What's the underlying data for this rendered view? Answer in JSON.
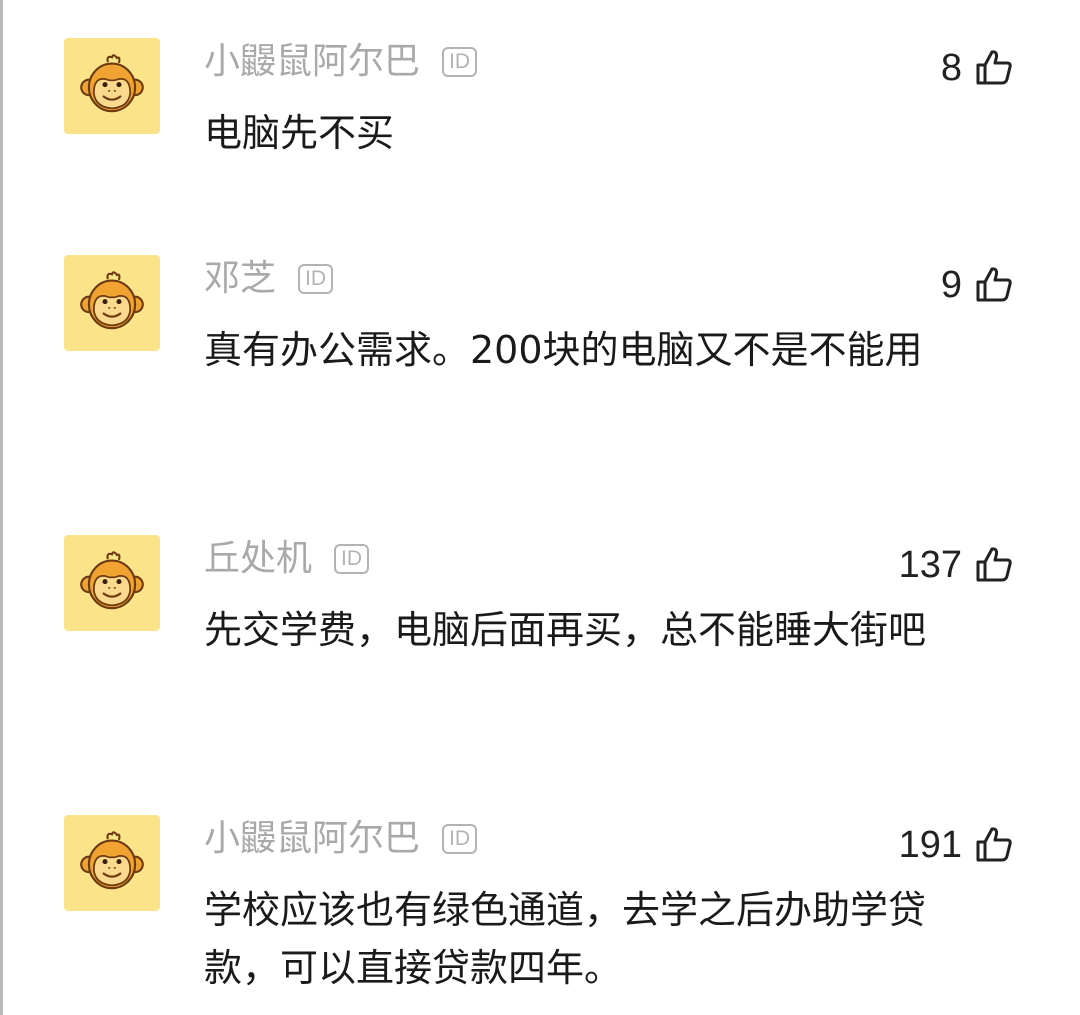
{
  "comments": [
    {
      "username": "小鼹鼠阿尔巴",
      "badge": "ID",
      "likes": "8",
      "text": "电脑先不买"
    },
    {
      "username": "邓芝",
      "badge": "ID",
      "likes": "9",
      "text": "真有办公需求。200块的电脑又不是不能用"
    },
    {
      "username": "丘处机",
      "badge": "ID",
      "likes": "137",
      "text": "先交学费，电脑后面再买，总不能睡大街吧"
    },
    {
      "username": "小鼹鼠阿尔巴",
      "badge": "ID",
      "likes": "191",
      "text": "学校应该也有绿色通道，去学之后办助学贷款，可以直接贷款四年。"
    }
  ],
  "icons": {
    "avatar": "monkey-avatar-icon",
    "like": "thumbs-up-icon"
  },
  "colors": {
    "avatar_bg": "#fbe38a",
    "username": "#a9a9a9",
    "text": "#1a1a1a"
  }
}
